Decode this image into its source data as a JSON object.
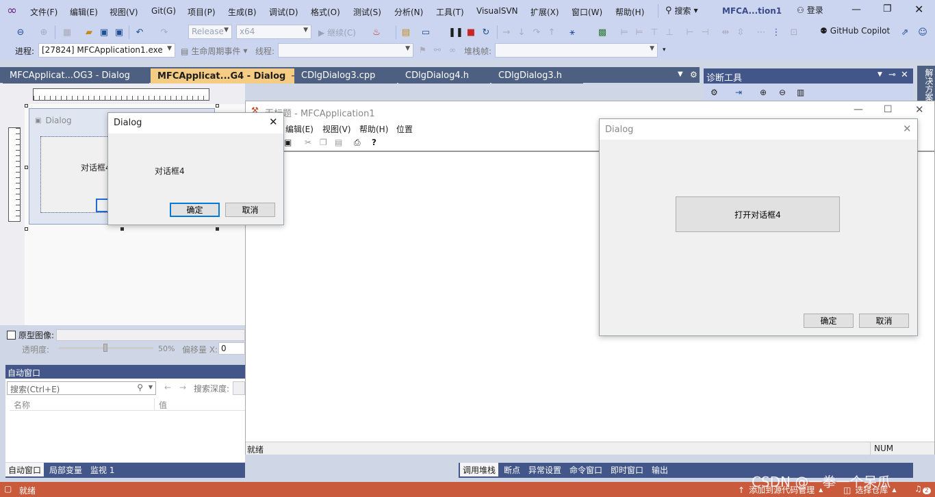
{
  "menubar": {
    "items": [
      "文件(F)",
      "编辑(E)",
      "视图(V)",
      "Git(G)",
      "项目(P)",
      "生成(B)",
      "调试(D)",
      "格式(O)",
      "测试(S)",
      "分析(N)",
      "工具(T)",
      "VisualSVN",
      "扩展(X)",
      "窗口(W)",
      "帮助(H)"
    ],
    "search_label": "搜索",
    "solution_title": "MFCA...tion1",
    "login_label": "登录"
  },
  "toolbar1": {
    "config": "Release",
    "platform": "x64",
    "continue_label": "继续(C)",
    "copilot_label": "GitHub Copilot"
  },
  "toolbar2": {
    "process_label": "进程:",
    "process_value": "[27824] MFCApplication1.exe",
    "lifecycle_label": "生命周期事件",
    "thread_label": "线程:",
    "stackframe_label": "堆栈帧:"
  },
  "tabs": [
    {
      "label": "MFCApplicat...OG3 - Dialog"
    },
    {
      "label": "MFCApplicat...G4 - Dialog"
    },
    {
      "label": "CDlgDialog3.cpp"
    },
    {
      "label": "CDlgDialog4.h"
    },
    {
      "label": "CDlgDialog3.h"
    }
  ],
  "designer": {
    "dialog_title": "Dialog",
    "dialog_text": "对话框4",
    "prototype_label": "原型图像:",
    "opacity_label": "透明度:",
    "opacity_value": "50%",
    "offset_label": "偏移量 X:",
    "offset_value": "0"
  },
  "popup_dialog": {
    "title": "Dialog",
    "text": "对话框4",
    "ok_label": "确定",
    "cancel_label": "取消"
  },
  "mfc_app": {
    "title": "无标题 - MFCApplication1",
    "menu": [
      "编辑(E)",
      "视图(V)",
      "帮助(H)",
      "位置"
    ],
    "status": "就绪",
    "num": "NUM"
  },
  "main_dialog": {
    "title": "Dialog",
    "open_button": "打开对话框4",
    "ok_label": "确定",
    "cancel_label": "取消"
  },
  "diag_tools": {
    "title": "诊断工具",
    "side_label": "解决方案"
  },
  "autowin": {
    "title": "自动窗口",
    "search_placeholder": "搜索(Ctrl+E)",
    "depth_label": "搜索深度:",
    "col_name": "名称",
    "col_value": "值"
  },
  "bottom_tabs_left": [
    "自动窗口",
    "局部变量",
    "监视 1"
  ],
  "bottom_tabs_right": [
    "调用堆栈",
    "断点",
    "异常设置",
    "命令窗口",
    "即时窗口",
    "输出"
  ],
  "statusbar": {
    "ready": "就绪",
    "source_control": "添加到源代码管理",
    "repo": "选择仓库",
    "watermark": "CSDN @一拳一个呆瓜",
    "badge": "2"
  }
}
